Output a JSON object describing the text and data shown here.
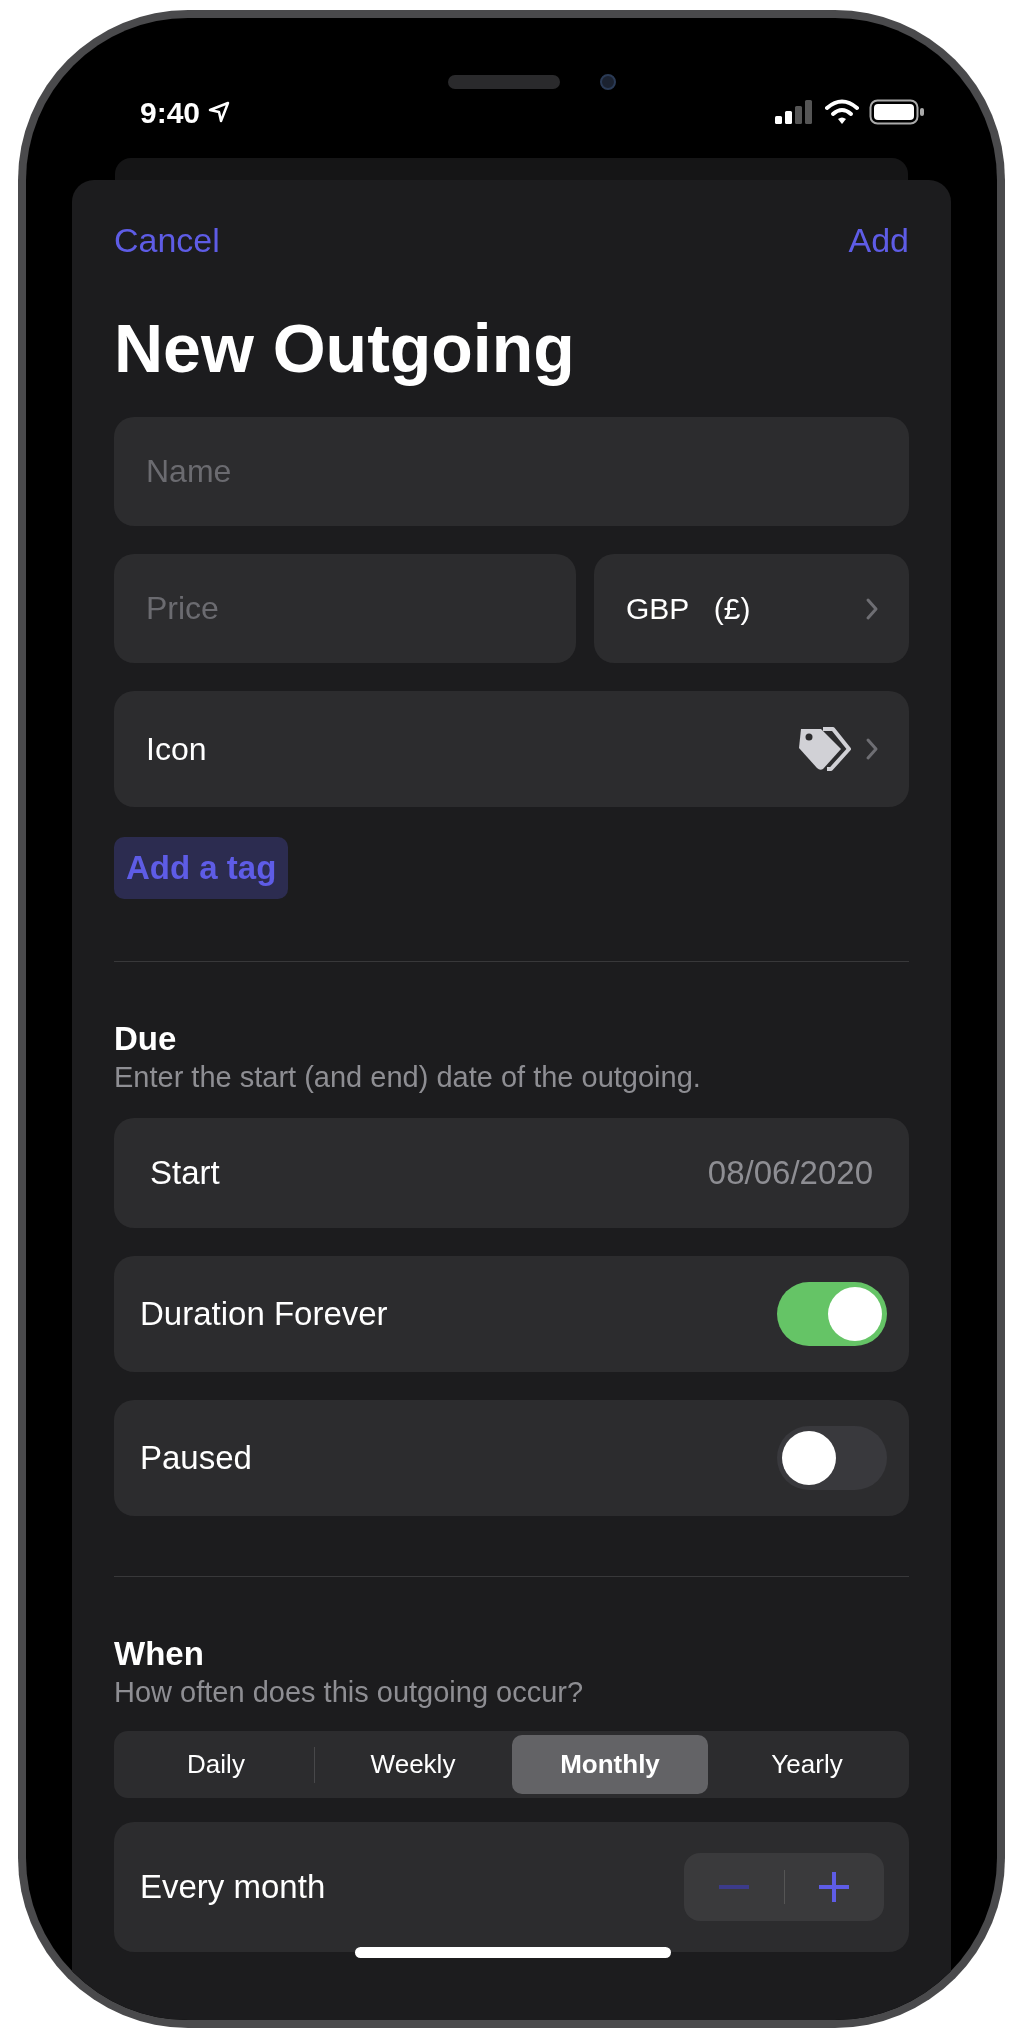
{
  "status_bar": {
    "time": "9:40"
  },
  "nav": {
    "cancel": "Cancel",
    "add": "Add"
  },
  "title": "New Outgoing",
  "name_field": {
    "placeholder": "Name"
  },
  "price_field": {
    "placeholder": "Price"
  },
  "currency": {
    "code": "GBP",
    "symbol": "(£)"
  },
  "icon_row": {
    "label": "Icon"
  },
  "add_tag": "Add a tag",
  "due": {
    "title": "Due",
    "subtitle": "Enter the start (and end) date of the outgoing."
  },
  "start": {
    "label": "Start",
    "value": "08/06/2020"
  },
  "toggles": [
    {
      "label": "Duration Forever",
      "on": true
    },
    {
      "label": "Paused",
      "on": false
    }
  ],
  "when": {
    "title": "When",
    "subtitle": "How often does this outgoing occur?"
  },
  "segments": [
    {
      "label": "Daily",
      "selected": false
    },
    {
      "label": "Weekly",
      "selected": false
    },
    {
      "label": "Monthly",
      "selected": true
    },
    {
      "label": "Yearly",
      "selected": false
    }
  ],
  "stepper": {
    "label": "Every month",
    "decrement_disabled": true
  }
}
